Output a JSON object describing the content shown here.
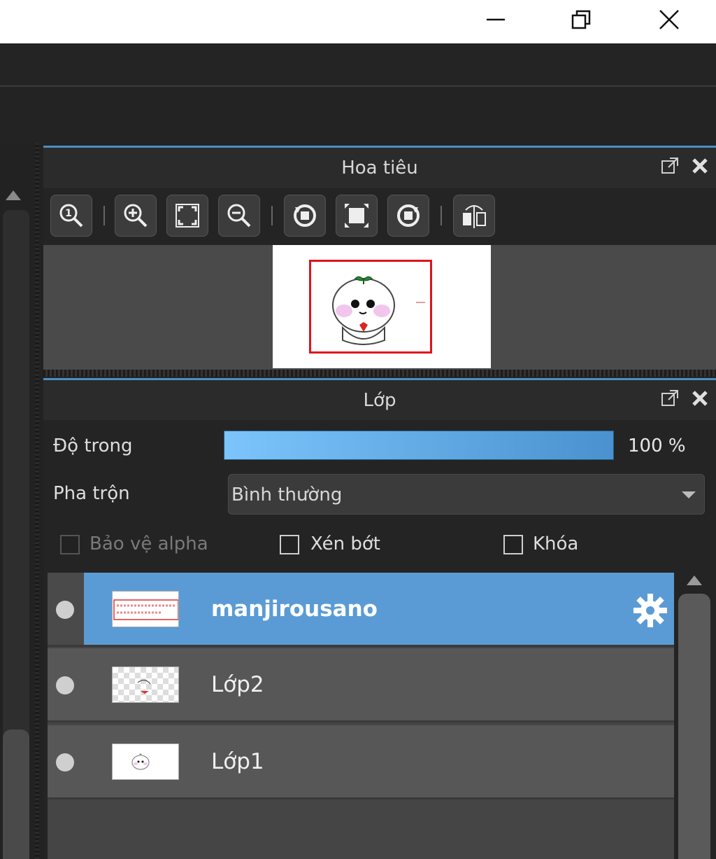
{
  "window": {
    "controls": [
      "minimize-icon",
      "restore-icon",
      "close-icon"
    ]
  },
  "navigator": {
    "title": "Hoa tiêu",
    "tools": [
      "zoom-actual-icon",
      "zoom-in-icon",
      "fit-screen-icon",
      "zoom-out-icon",
      "rotate-left-icon",
      "reset-view-icon",
      "rotate-right-icon",
      "flip-horizontal-icon"
    ]
  },
  "layers": {
    "title": "Lớp",
    "opacity_label": "Độ trong",
    "opacity_value": "100 %",
    "opacity": 100,
    "blend_label": "Pha trộn",
    "blend_value": "Bình thường",
    "protect_alpha": "Bảo vệ alpha",
    "clipping": "Xén bớt",
    "lock": "Khóa",
    "items": [
      {
        "name": "manjirousano",
        "selected": true
      },
      {
        "name": "Lớp2",
        "selected": false
      },
      {
        "name": "Lớp1",
        "selected": false
      }
    ]
  },
  "colors": {
    "accent": "#5a9bd5",
    "panel_border": "#4a8fc4",
    "view_rect": "#e0141e"
  }
}
